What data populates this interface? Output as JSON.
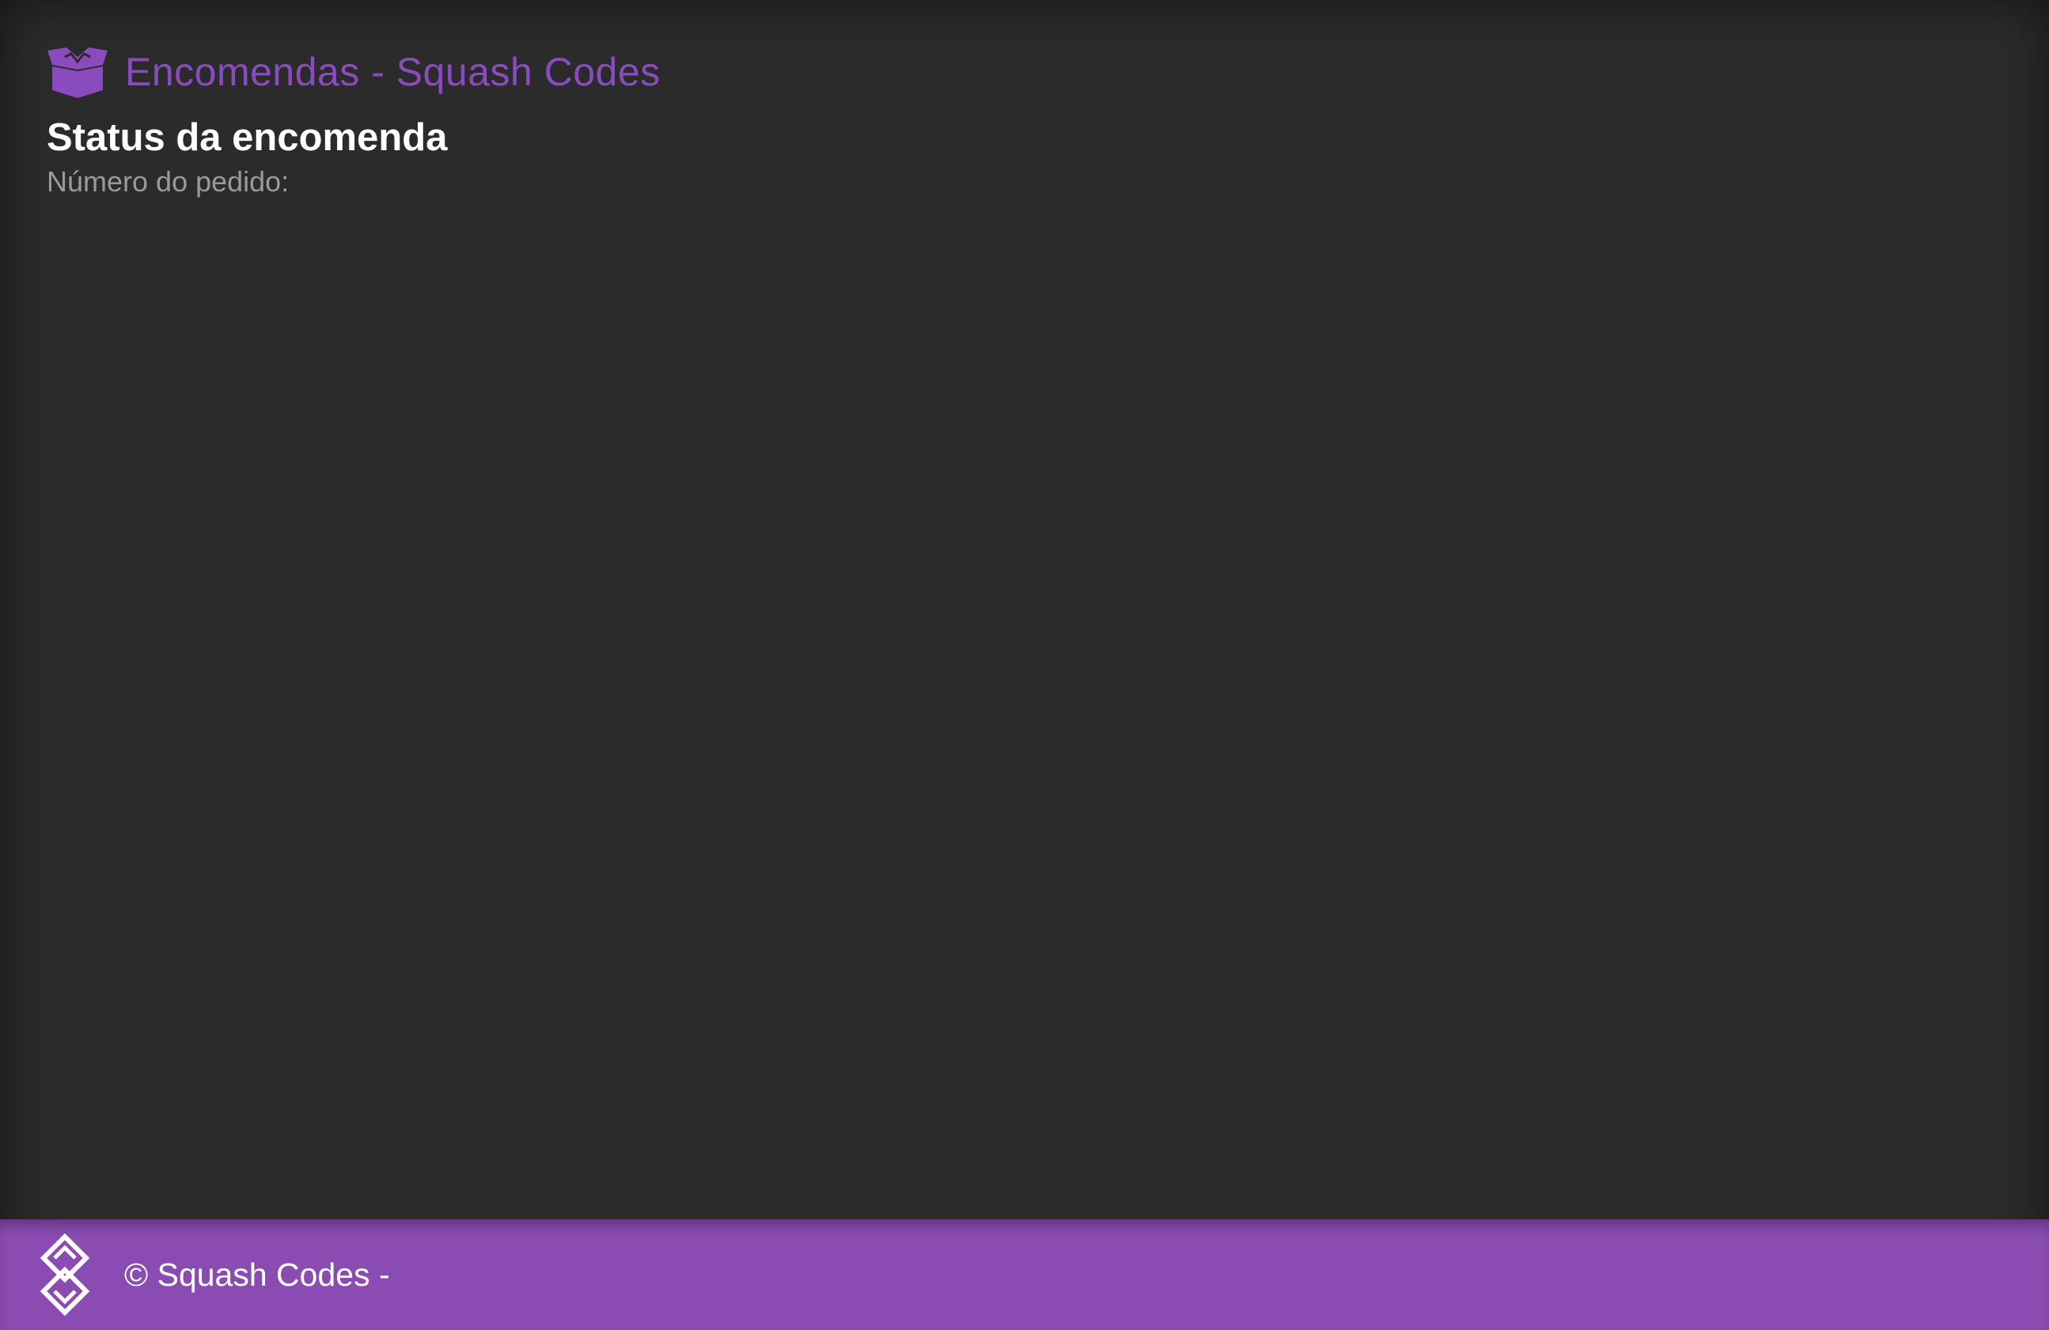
{
  "header": {
    "icon": "box-open-icon",
    "title": "Encomendas - Squash Codes"
  },
  "main": {
    "title": "Status da encomenda",
    "order_label": "Número do pedido:"
  },
  "footer": {
    "logo_icon": "squash-codes-logo",
    "copyright": "© Squash Codes -"
  },
  "colors": {
    "accent": "#8a4bbf",
    "background": "#2b2b2b",
    "footer": "#8a4cb2"
  }
}
